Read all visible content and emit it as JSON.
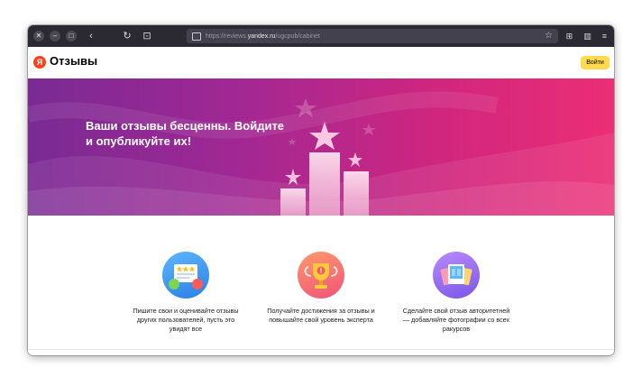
{
  "browser": {
    "url_prefix": "https://reviews.",
    "url_domain": "yandex.ru",
    "url_path": "/ugcpub/cabinet",
    "icons": [
      "close-icon",
      "minimize-icon",
      "maximize-icon",
      "back-icon",
      "reload-icon",
      "reader-icon",
      "star-icon",
      "extensions-icon",
      "library-icon",
      "menu-icon"
    ]
  },
  "header": {
    "logo_letter": "Я",
    "brand": "Отзывы",
    "login_label": "Войти"
  },
  "hero": {
    "title": "Ваши отзывы бесценны. Войдите и опубликуйте их!"
  },
  "features": [
    {
      "icon": "reviews-rating-icon",
      "caption": "Пишите свои и оценивайте отзывы других пользователей, пусть это увидят все"
    },
    {
      "icon": "trophy-icon",
      "caption": "Получайте достижения за отзывы и повышайте свой уровень эксперта"
    },
    {
      "icon": "photos-icon",
      "caption": "Сделайте свой отзыв авторитетней — добавляйте фотографии со всех ракурсов"
    }
  ],
  "colors": {
    "accent_yellow": "#ffdb4d",
    "yandex_red": "#fc3f1d",
    "hero_start": "#7a2a94",
    "hero_end": "#ec2e75"
  }
}
